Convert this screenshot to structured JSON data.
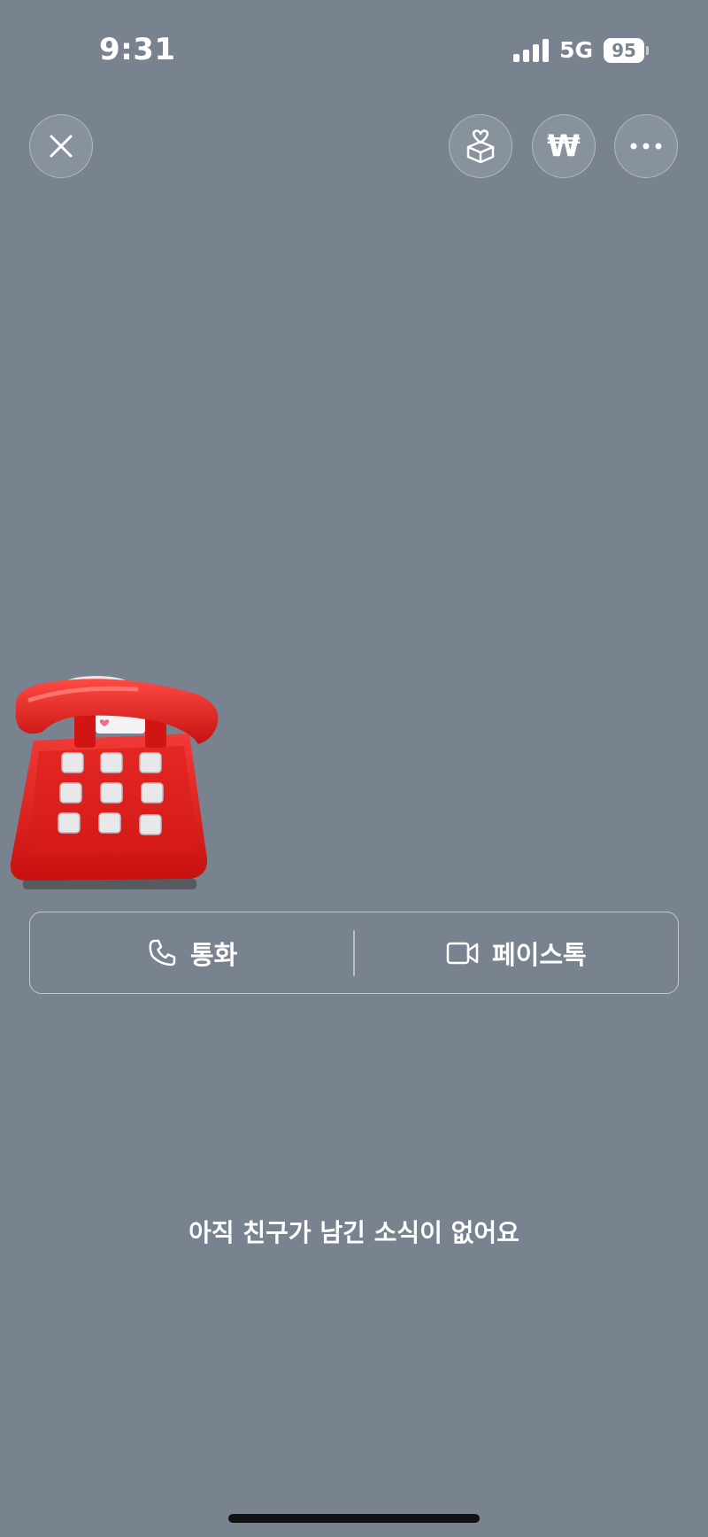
{
  "status_bar": {
    "time": "9:31",
    "network": "5G",
    "battery": "95"
  },
  "header": {
    "close_icon": "close-icon",
    "gift_icon": "gift-box-heart-icon",
    "won_icon": "won-currency-icon",
    "won_symbol": "₩",
    "more_icon": "more-dots-icon"
  },
  "sticker": {
    "icon": "red-telephone-sticker"
  },
  "call_options": {
    "voice_label": "통화",
    "voice_icon": "phone-icon",
    "video_label": "페이스톡",
    "video_icon": "video-camera-icon"
  },
  "empty_state": {
    "message": "아직 친구가 남긴 소식이 없어요"
  }
}
